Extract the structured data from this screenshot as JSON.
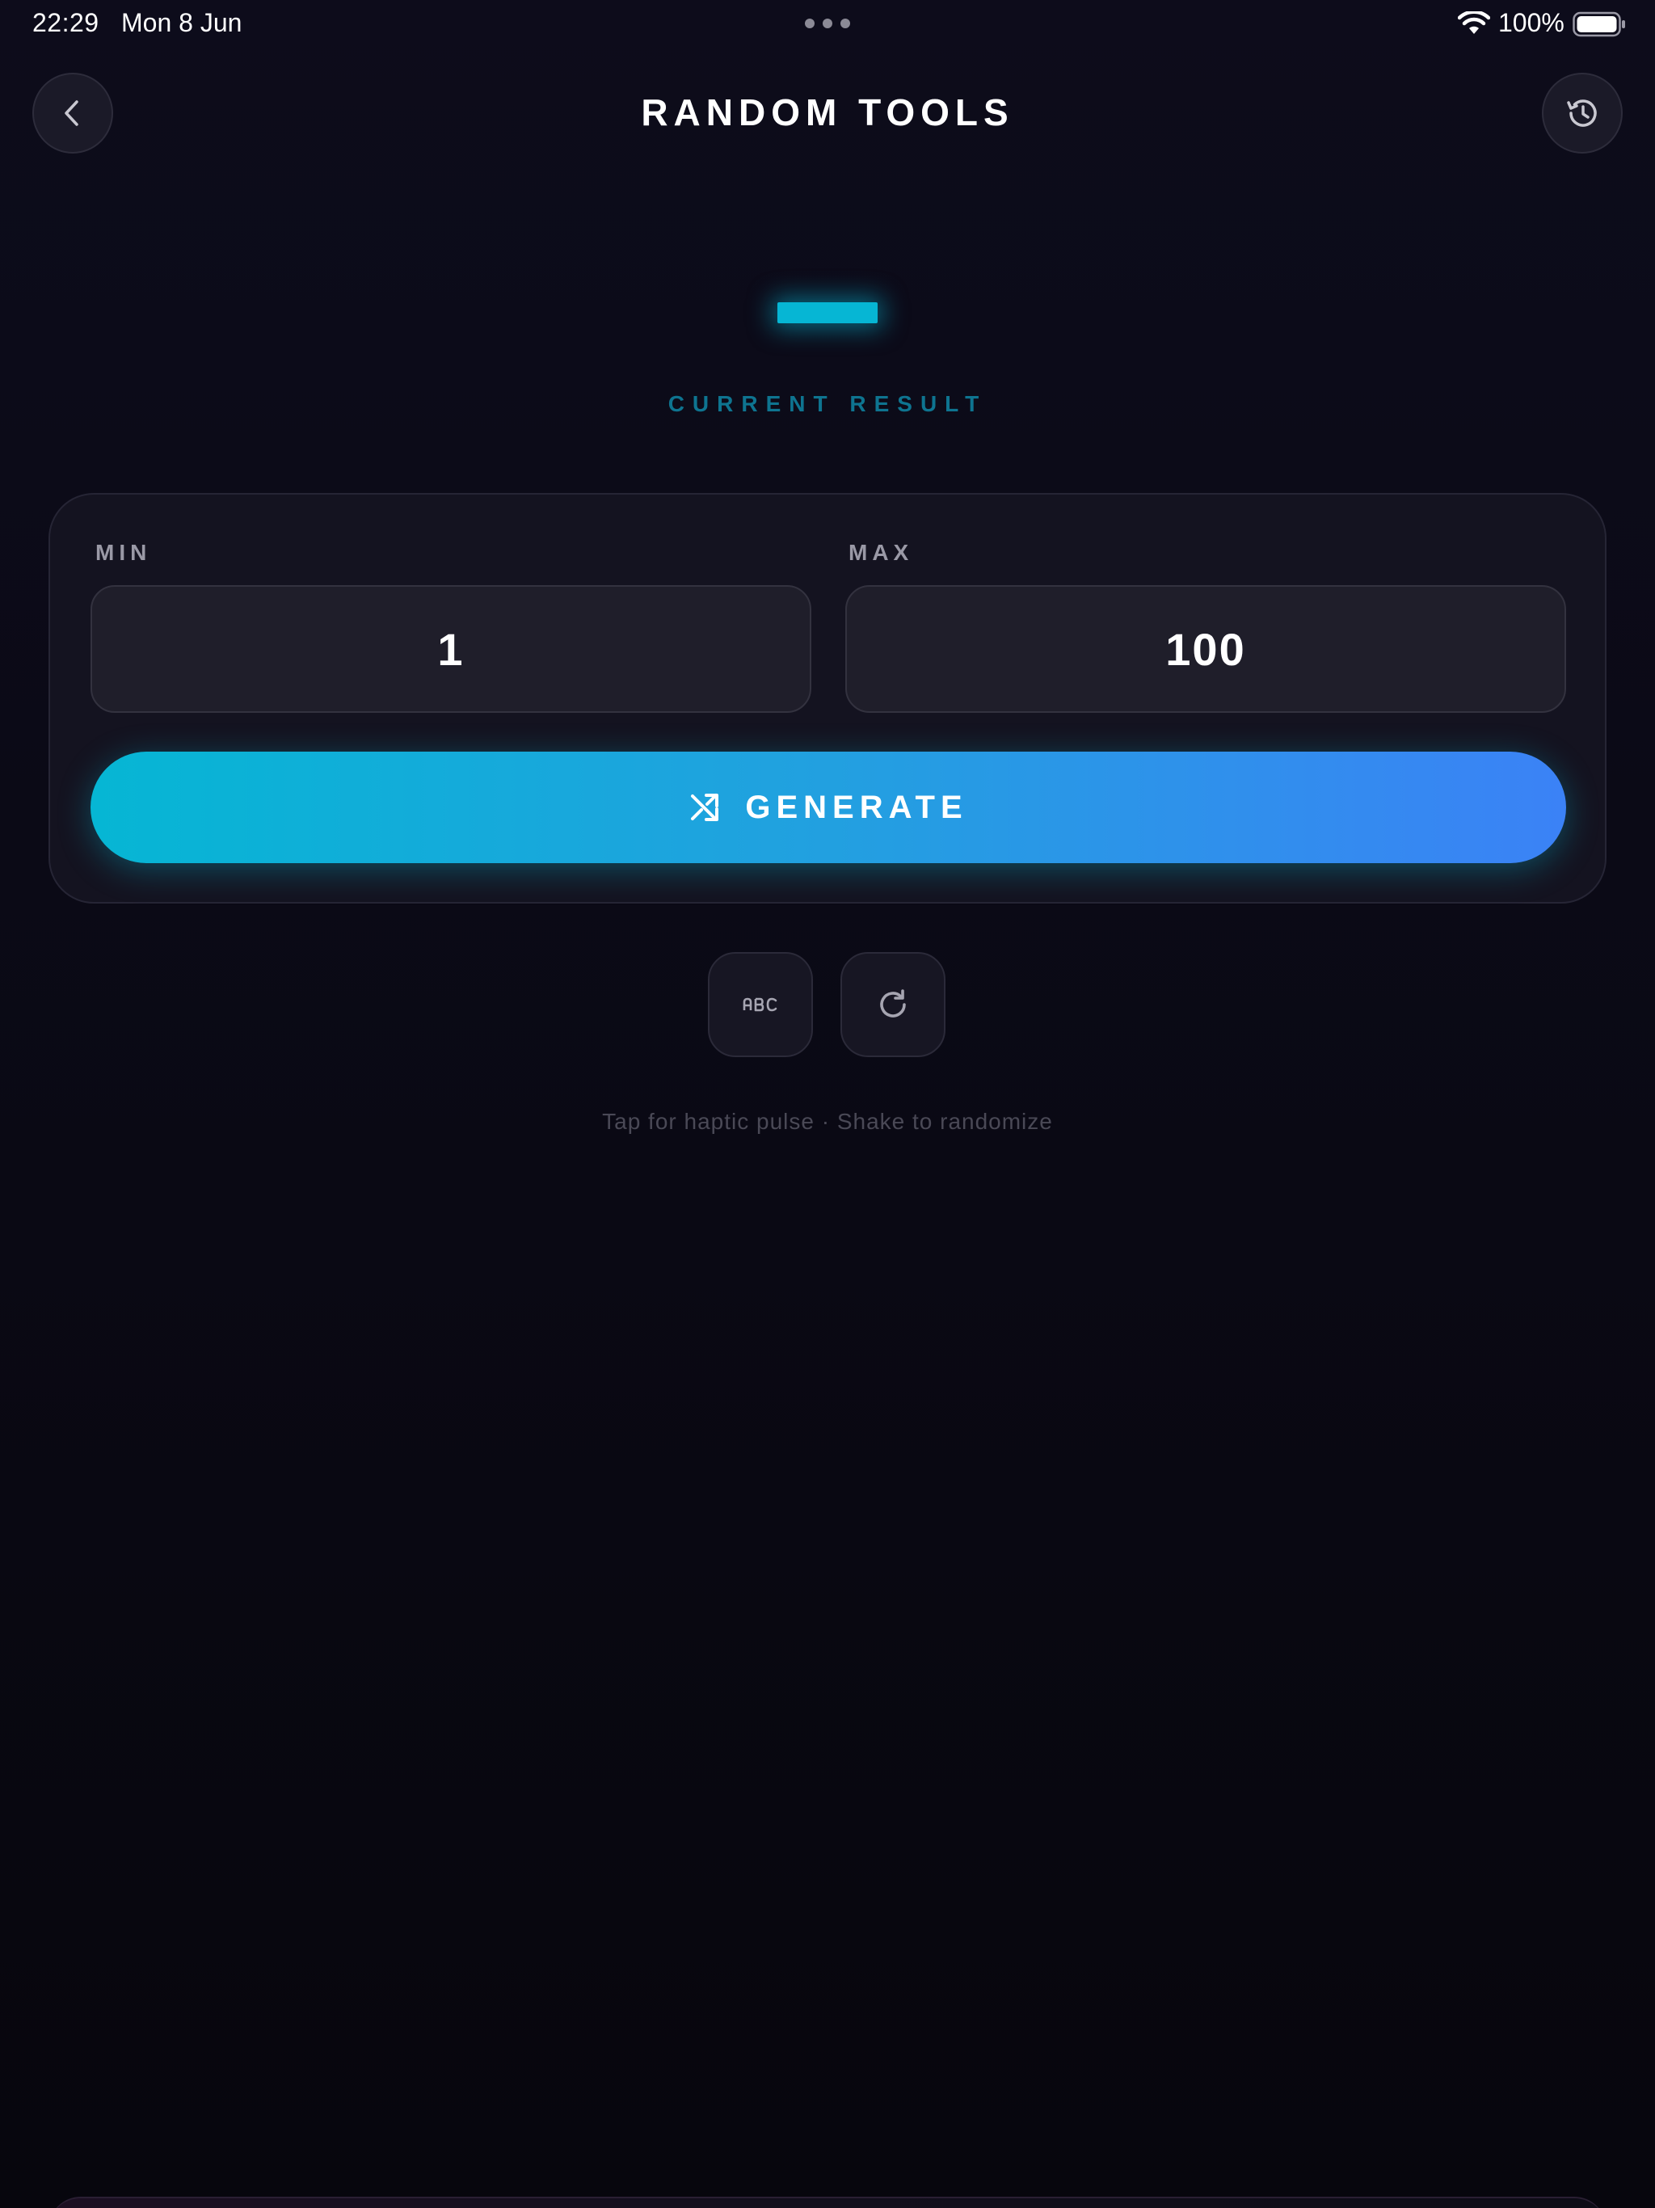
{
  "status_bar": {
    "time": "22:29",
    "date": "Mon 8 Jun",
    "battery": "100%"
  },
  "header": {
    "title": "RANDOM TOOLS",
    "back_icon": "chevron-left-icon",
    "history_icon": "history-icon"
  },
  "result": {
    "label": "CURRENT RESULT",
    "color": "#06b6d4"
  },
  "range": {
    "min_label": "MIN",
    "min_value": "1",
    "max_label": "MAX",
    "max_value": "100"
  },
  "generate": {
    "label": "GENERATE",
    "icon": "shuffle-icon",
    "gradient_start": "#06b6d4",
    "gradient_end": "#3b82f6"
  },
  "tools": {
    "abc_icon": "abc-icon",
    "reset_icon": "reset-icon"
  },
  "hint": "Tap for haptic pulse · Shake to randomize"
}
